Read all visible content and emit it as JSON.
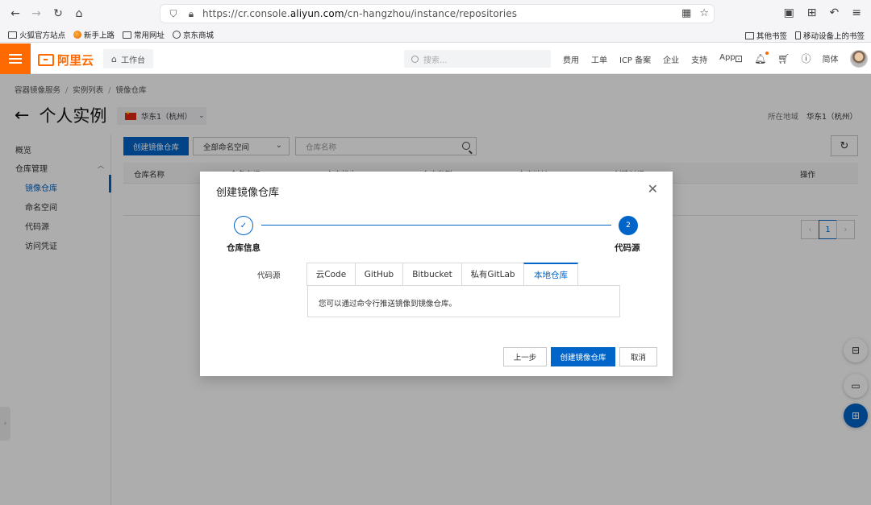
{
  "browser": {
    "url_prefix": "https://cr.console.",
    "url_domain": "aliyun.com",
    "url_path": "/cn-hangzhou/instance/repositories",
    "bookmarks": [
      "火狐官方站点",
      "新手上路",
      "常用网址",
      "京东商城"
    ],
    "bookmarks_right": [
      "其他书签",
      "移动设备上的书签"
    ]
  },
  "header": {
    "logo_text": "阿里云",
    "workbench_label": "工作台",
    "search_placeholder": "搜索...",
    "links": [
      "费用",
      "工单",
      "ICP 备案",
      "企业",
      "支持",
      "App"
    ],
    "lang_label": "简体",
    "brand_color": "#ff6a00"
  },
  "breadcrumb": [
    "容器镜像服务",
    "实例列表",
    "镜像仓库"
  ],
  "page": {
    "title": "个人实例",
    "region_selector": "华东1（杭州）",
    "region_label": "所在地域",
    "region_value": "华东1（杭州）"
  },
  "sidebar": {
    "overview": "概览",
    "group": "仓库管理",
    "items": [
      "镜像仓库",
      "命名空间",
      "代码源",
      "访问凭证"
    ],
    "active_index": 0
  },
  "toolbar": {
    "create_button": "创建镜像仓库",
    "namespace_select": "全部命名空间",
    "search_placeholder": "仓库名称"
  },
  "table": {
    "columns": [
      "仓库名称",
      "命名空间",
      "仓库状态",
      "仓库类型",
      "仓库地址",
      "创建时间",
      "操作"
    ]
  },
  "pagination": {
    "current_page": "1"
  },
  "modal": {
    "title": "创建镜像仓库",
    "steps": [
      {
        "label": "仓库信息",
        "status": "done"
      },
      {
        "label": "代码源",
        "number": "2",
        "status": "current"
      }
    ],
    "field_label": "代码源",
    "tabs": [
      "云Code",
      "GitHub",
      "Bitbucket",
      "私有GitLab",
      "本地仓库"
    ],
    "active_tab_index": 4,
    "panel_text": "您可以通过命令行推送镜像到镜像仓库。",
    "buttons": {
      "prev": "上一步",
      "create": "创建镜像仓库",
      "cancel": "取消"
    },
    "accent_color": "#0064c8"
  }
}
